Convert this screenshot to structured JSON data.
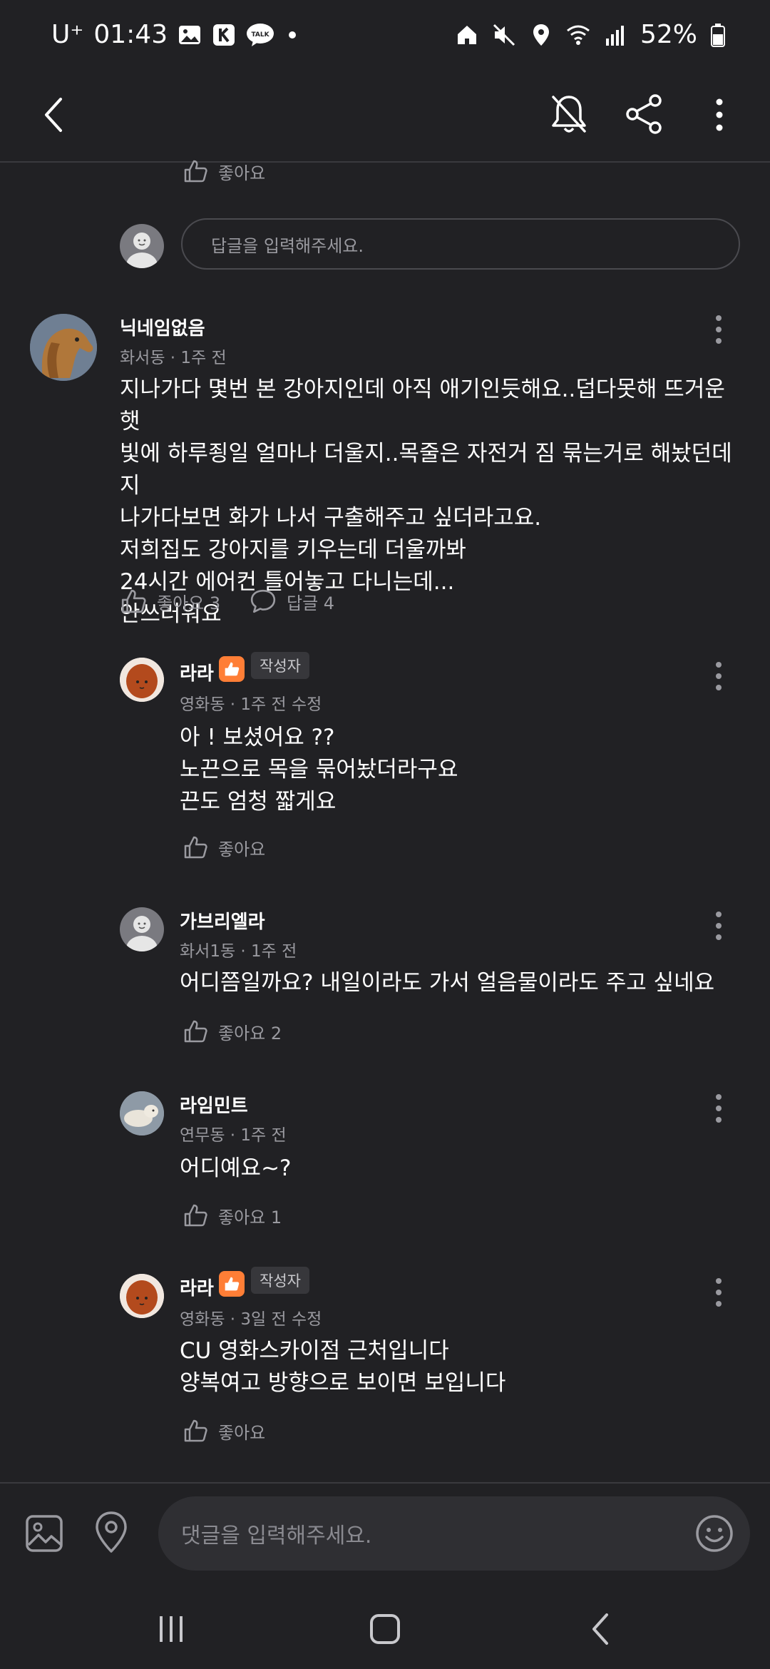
{
  "status_bar": {
    "carrier": "U⁺",
    "time": "01:43",
    "battery": "52%"
  },
  "top_bar": {
    "back": "back-icon",
    "mute": "bell-off-icon",
    "share": "share-icon",
    "menu": "more-vertical-icon"
  },
  "partial_like": {
    "label": "좋아요"
  },
  "reply_input": {
    "placeholder": "답글을 입력해주세요."
  },
  "comments": [
    {
      "name": "닉네임없음",
      "meta": "화서동 · 1주 전",
      "body": "지나가다 몇번 본 강아지인데 아직 애기인듯해요..덥다못해 뜨거운 햇\n빛에 하루죙일 얼마나 더울지..목줄은 자전거 짐 묶는거로 해놨던데 지\n나가다보면 화가 나서 구출해주고 싶더라고요.\n저희집도 강아지를 키우는데 더울까봐\n24시간 에어컨 틀어놓고 다니는데...\n안쓰러워요",
      "like_label": "좋아요 3",
      "reply_label": "답글 4"
    }
  ],
  "replies": [
    {
      "name": "라라",
      "author_tag": "작성자",
      "meta": "영화동 · 1주 전 수정",
      "body": "아 ! 보셨어요 ??\n노끈으로 목을 묶어놨더라구요\n끈도 엄청 짧게요",
      "like_label": "좋아요"
    },
    {
      "name": "가브리엘라",
      "meta": "화서1동 · 1주 전",
      "body": "어디쯤일까요? 내일이라도 가서 얼음물이라도 주고 싶네요",
      "like_label": "좋아요 2"
    },
    {
      "name": "라임민트",
      "meta": "연무동 · 1주 전",
      "body": "어디예요~?",
      "like_label": "좋아요 1"
    },
    {
      "name": "라라",
      "author_tag": "작성자",
      "meta": "영화동 · 3일 전 수정",
      "body": "CU 영화스카이점 근처입니다\n양복여고 방향으로 보이면 보입니다",
      "like_label": "좋아요"
    }
  ],
  "bottom_bar": {
    "image": "image-icon",
    "location": "location-pin-icon",
    "placeholder": "댓글을 입력해주세요.",
    "emoji": "smile-icon"
  },
  "nav_bar": {
    "recents": "recents-icon",
    "home": "home-icon",
    "back": "nav-back-icon"
  },
  "colors": {
    "background": "#212124",
    "accent": "#ff7e36",
    "muted_text": "#9a9aa0"
  }
}
